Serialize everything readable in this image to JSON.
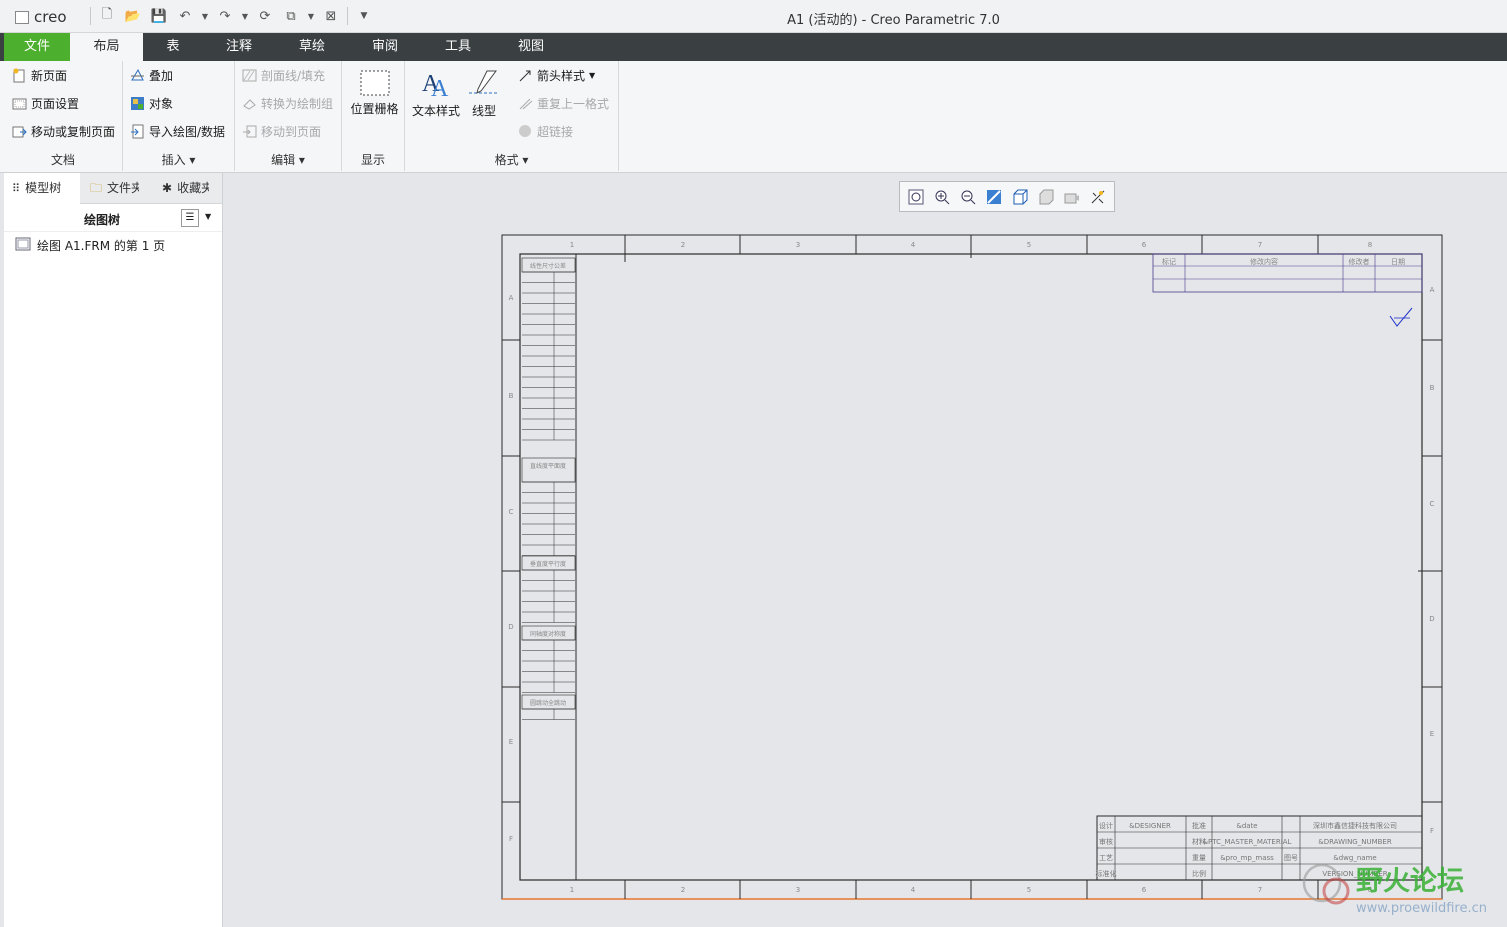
{
  "app": {
    "logo_text": "creo",
    "window_title": "A1 (活动的) - Creo Parametric 7.0"
  },
  "tabs": {
    "file": "文件",
    "layout": "布局",
    "table": "表",
    "annotate": "注释",
    "sketch": "草绘",
    "review": "审阅",
    "tools": "工具",
    "view": "视图"
  },
  "ribbon": {
    "document": {
      "label": "文档",
      "new_page": "新页面",
      "page_setup": "页面设置",
      "move_copy": "移动或复制页面"
    },
    "insert": {
      "label": "插入",
      "overlay": "叠加",
      "object": "对象",
      "import": "导入绘图/数据"
    },
    "edit": {
      "label": "编辑",
      "section_fill": "剖面线/填充",
      "convert_group": "转换为绘制组",
      "move_page": "移动到页面"
    },
    "display": {
      "label": "显示",
      "position_grid": "位置栅格"
    },
    "format": {
      "label": "格式",
      "text_style": "文本样式",
      "line_style": "线型",
      "arrow_style": "箭头样式",
      "repeat_format": "重复上一格式",
      "hyperlink": "超链接"
    }
  },
  "sidebar": {
    "tab_model_tree": "模型树",
    "tab_files": "文件夹",
    "tab_favorites": "收藏夹",
    "tree_title": "绘图树",
    "tree_item": "绘图 A1.FRM 的第 1 页"
  },
  "viewtools": [
    "refit-icon",
    "zoom-in-icon",
    "zoom-out-icon",
    "repaint-icon",
    "saved-views-icon",
    "display-style-icon",
    "layers-icon",
    "annotation-display-icon"
  ],
  "sheet": {
    "col_labels": [
      "1",
      "2",
      "3",
      "4",
      "5",
      "6",
      "7",
      "8"
    ],
    "row_labels": [
      "A",
      "B",
      "C",
      "D",
      "E",
      "F"
    ],
    "revision_headers": [
      "标记",
      "修改内容",
      "修改者",
      "日期"
    ],
    "title_block": {
      "designer_label": "设计",
      "designer_value": "&DESIGNER",
      "check_label": "审核",
      "process_label": "工艺",
      "standard_label": "标准化",
      "approve_label": "批准",
      "date_value": "&date",
      "company": "深圳市鑫信捷科技有限公司",
      "material_label": "材料",
      "material_value": "&PTC_MASTER_MATERIAL",
      "weight_label": "重量",
      "weight_value": "&pro_mp_mass",
      "drawing_no_value": "&DRAWING_NUMBER",
      "model_value": "&dwg_name",
      "mark_label": "图号",
      "scale_label": "比例",
      "version_value": "VERSION_NUMBER"
    },
    "tolerance_titles": [
      "线性尺寸公差",
      "直线度平面度",
      "垂直度平行度",
      "同轴度对称度",
      "圆跳动全跳动"
    ]
  },
  "watermark": {
    "title": "野火论坛",
    "url": "www.proewildfire.cn"
  },
  "colors": {
    "file_tab": "#4caf2d",
    "tabbar": "#3a3f42",
    "sheet_line": "#2b2b2b",
    "sheet_accent": "#4b3a8c"
  }
}
